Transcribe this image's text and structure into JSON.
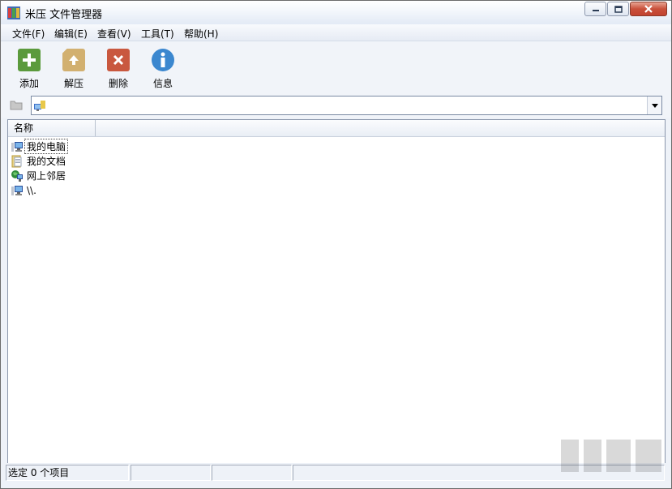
{
  "window": {
    "title": "米压 文件管理器",
    "controls": {
      "minimize": "minimize",
      "maximize": "maximize",
      "close": "close"
    }
  },
  "menu": [
    {
      "label": "文件(F)"
    },
    {
      "label": "编辑(E)"
    },
    {
      "label": "查看(V)"
    },
    {
      "label": "工具(T)"
    },
    {
      "label": "帮助(H)"
    }
  ],
  "toolbar": {
    "add": {
      "label": "添加",
      "icon": "plus-icon",
      "color": "#5b9a3c"
    },
    "extract": {
      "label": "解压",
      "icon": "extract-up-arrow-icon",
      "color": "#d2b070"
    },
    "delete": {
      "label": "删除",
      "icon": "delete-x-icon",
      "color": "#c9583f"
    },
    "info": {
      "label": "信息",
      "icon": "info-icon",
      "color": "#3b87cf"
    }
  },
  "address": {
    "value": "",
    "icon": "computer-icon"
  },
  "list": {
    "columns": [
      {
        "label": "名称"
      }
    ],
    "items": [
      {
        "label": "我的电脑",
        "icon": "computer-icon",
        "focused": true
      },
      {
        "label": "我的文档",
        "icon": "documents-folder-icon"
      },
      {
        "label": "网上邻居",
        "icon": "network-icon"
      },
      {
        "label": "\\\\.",
        "icon": "computer-icon"
      }
    ]
  },
  "status": {
    "selected": "选定 0 个项目",
    "cell2": "",
    "cell3": "",
    "cell4": ""
  }
}
